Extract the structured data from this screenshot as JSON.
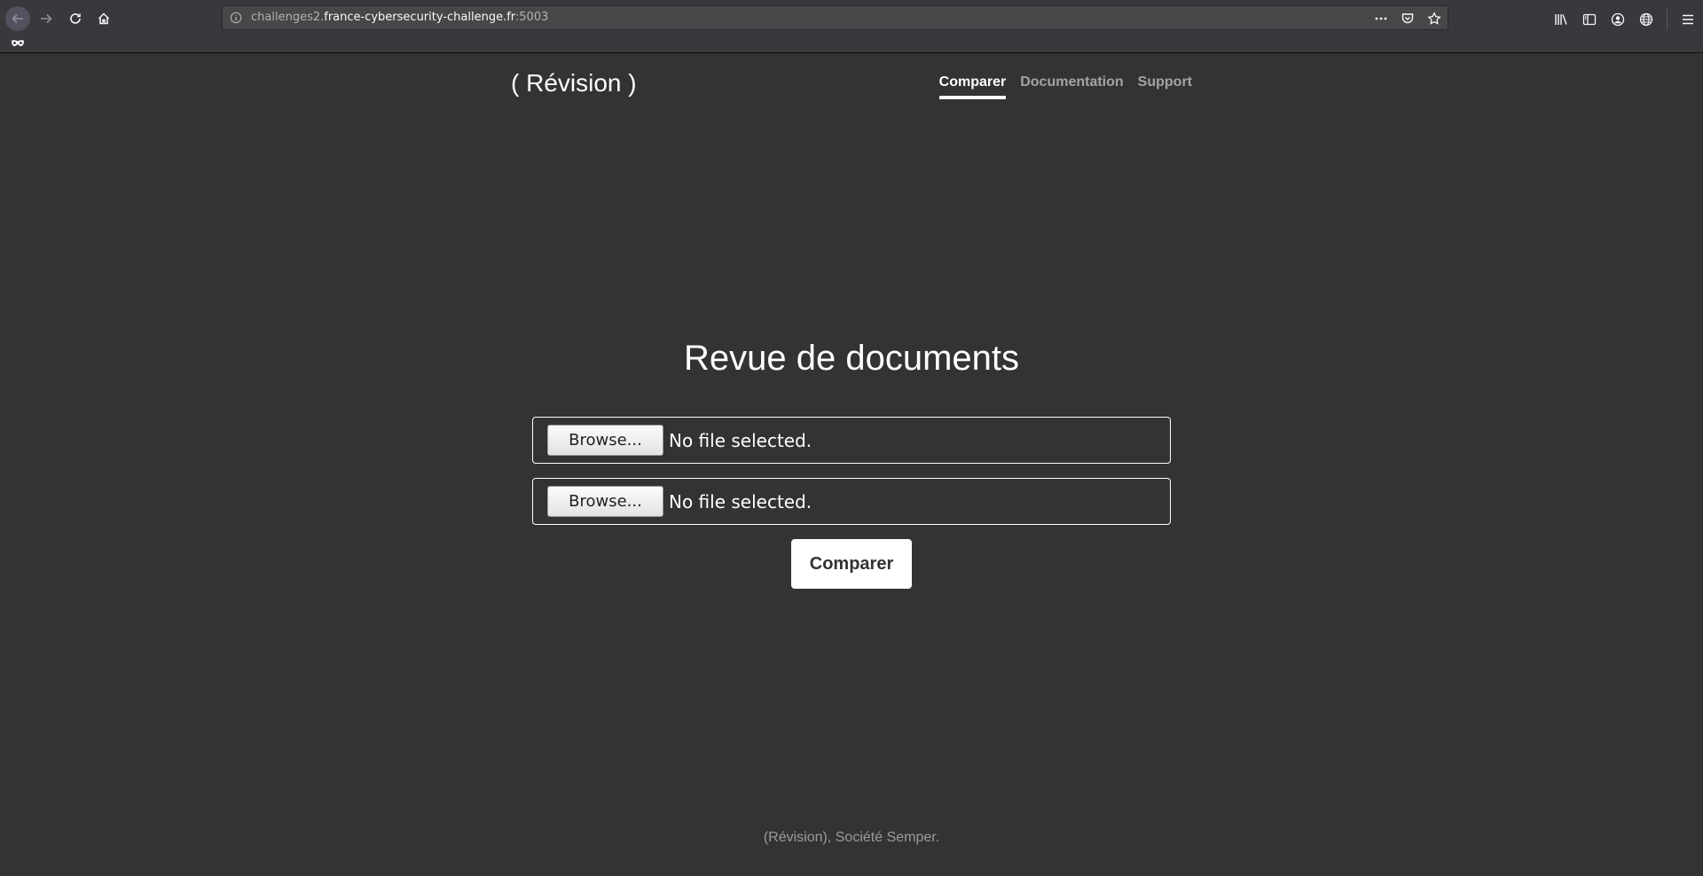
{
  "browser": {
    "url_prefix": "challenges2.",
    "url_domain": "france-cybersecurity-challenge.fr",
    "url_port": ":5003"
  },
  "header": {
    "brand": "( Révision )",
    "nav": [
      {
        "label": "Comparer",
        "active": true
      },
      {
        "label": "Documentation",
        "active": false
      },
      {
        "label": "Support",
        "active": false
      }
    ]
  },
  "main": {
    "title": "Revue de documents",
    "file_inputs": [
      {
        "button_label": "Browse...",
        "status": "No file selected."
      },
      {
        "button_label": "Browse...",
        "status": "No file selected."
      }
    ],
    "submit_label": "Comparer"
  },
  "footer": {
    "text": "(Révision), Société Semper."
  },
  "colors": {
    "background": "#333333",
    "chrome": "#38383d",
    "text": "#ffffff"
  }
}
